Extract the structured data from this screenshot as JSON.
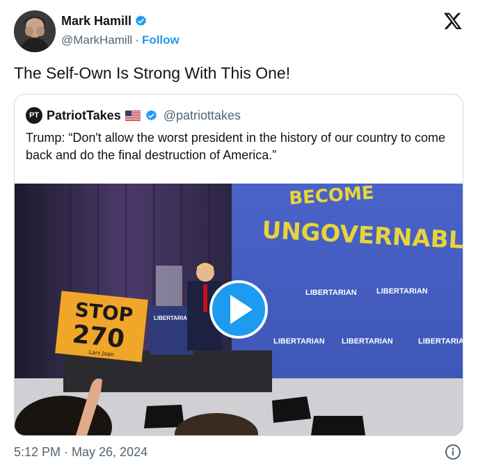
{
  "author": {
    "name": "Mark Hamill",
    "handle": "@MarkHamill",
    "separator": "·",
    "follow_label": "Follow",
    "verified": true
  },
  "tweet": {
    "text": "The Self-Own Is Strong With This One!",
    "timestamp": "5:12 PM · May 26, 2024"
  },
  "quoted": {
    "avatar_initials": "PT",
    "name": "PatriotTakes",
    "flag": "us-flag",
    "handle": "@patriottakes",
    "text": "Trump: “Don't allow the worst president in the history of our country to come back and do the final destruction of America.”",
    "media": {
      "type": "video",
      "screen_text": "BECOME UNGOVERNABLE",
      "banner_text": "LIBERTARIAN",
      "sign_line1": "STOP",
      "sign_line2": "270",
      "sign_small": "Lars Joan"
    }
  },
  "colors": {
    "accent": "#1d9bf0",
    "text": "#0f1419",
    "muted": "#536471",
    "border": "#cfd9de",
    "sign": "#f0a628"
  },
  "icons": {
    "verified": "verified-badge-icon",
    "x_logo": "x-logo-icon",
    "play": "play-icon",
    "info": "info-icon"
  }
}
